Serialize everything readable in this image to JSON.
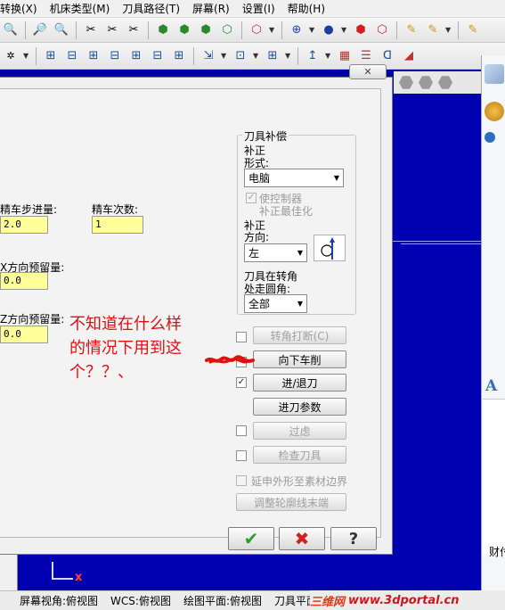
{
  "menu": [
    "转换(X)",
    "机床类型(M)",
    "刀具路径(T)",
    "屏幕(R)",
    "设置(I)",
    "帮助(H)"
  ],
  "dialog": {
    "close_label": "✕",
    "finish_step_label": "精车步进量:",
    "finish_step_value": "2.0",
    "finish_count_label": "精车次数:",
    "finish_count_value": "1",
    "dir_stock_label_1": "X方向预留量:",
    "dir_stock_value_1": "0.0",
    "dir_stock_label_2": "Z方向预留量:",
    "dir_stock_value_2": "0.0",
    "comp_group_title": "刀具补偿",
    "comp_type_label_1": "补正",
    "comp_type_label_2": "形式:",
    "comp_type_value": "电脑",
    "use_controller_label": "使控制器",
    "optimize_label": "补正最佳化",
    "comp_dir_label_1": "补正",
    "comp_dir_label_2": "方向:",
    "comp_dir_value": "左",
    "corner_label_1": "刀具在转角",
    "corner_label_2": "处走圆角:",
    "corner_value": "全部",
    "buttons": {
      "corner_break": "转角打断(C)",
      "plunge": "向下车削",
      "lead_in_out": "进/退刀",
      "plunge_params": "进刀参数",
      "filter": "过虑",
      "check_tool": "检查刀具",
      "extend_stock": "延申外形至素材边界",
      "adjust_contour": "调整轮廓线末端"
    },
    "ok_symbol": "✔",
    "cancel_symbol": "✖",
    "help_symbol": "?"
  },
  "annotation": {
    "line1": "不知道在什么样",
    "line2": "的情况下用到这",
    "line3": "个？？、"
  },
  "right_panel": {
    "letter": "A",
    "text": "财付"
  },
  "axis_label": "x",
  "status": {
    "screen_view": "屏幕视角:俯视图",
    "wcs": "WCS:俯视图",
    "plane": "绘图平面:俯视图",
    "tool_plane": "刀具平面"
  },
  "watermark": {
    "part1": "三维网",
    "part2": "www.3dportal.cn"
  }
}
